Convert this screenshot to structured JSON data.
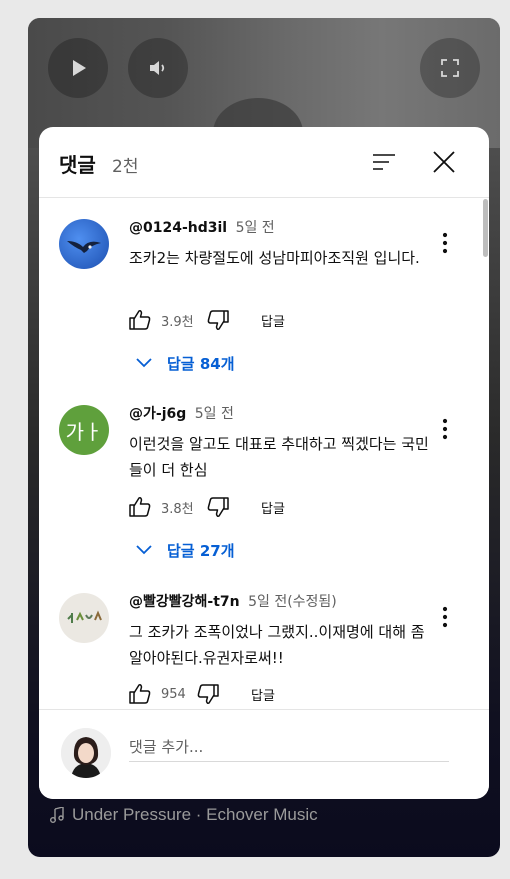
{
  "player": {
    "music_text": "Under Pressure · Echover Music",
    "icons": [
      "play-icon",
      "volume-icon",
      "fullscreen-icon",
      "music-note-icon"
    ]
  },
  "comments_panel": {
    "title": "댓글",
    "count": "2천",
    "icons": [
      "sort-icon",
      "close-icon"
    ],
    "comments": [
      {
        "author": "@0124-hd3il",
        "time": "5일 전",
        "text": "조카2는 차량절도에 성남마피아조직원 입니다.",
        "likes": "3.9천",
        "reply_label": "답글",
        "replies_label": "답글 84개",
        "avatar_icon": "eagle-avatar"
      },
      {
        "author": "@가-j6g",
        "time": "5일 전",
        "text": "이런것을 알고도  대표로 추대하고 찍겠다는  국민들이 더 한심",
        "likes": "3.8천",
        "reply_label": "답글",
        "replies_label": "답글 27개",
        "avatar_text": "가ㅏ",
        "avatar_color": "#5fa03c"
      },
      {
        "author": "@빨강빨강해-t7n",
        "time": "5일 전(수정됨)",
        "text": "그 조카가 조폭이었나 그랬지..이재명에 대해 좀 알아야된다.유권자로써!!",
        "likes": "954",
        "reply_label": "답글",
        "avatar_icon": "leaves-avatar"
      }
    ],
    "add_comment_placeholder": "댓글 추가..."
  },
  "colors": {
    "accent_link": "#065fd4",
    "secondary_text": "#606060",
    "primary_text": "#0f0f0f"
  }
}
